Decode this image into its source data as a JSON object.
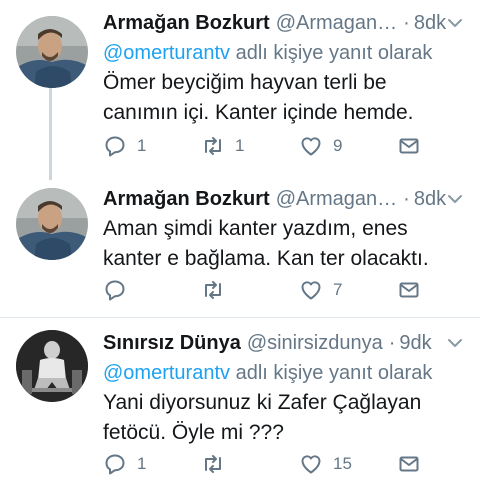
{
  "tweets": [
    {
      "name": "Armağan Bozkurt",
      "handle": "@Armagan…",
      "dot": "·",
      "time": "8dk",
      "reply_mention": "@omerturantv",
      "reply_suffix": " adlı kişiye yanıt olarak",
      "text": "Ömer beyciğim hayvan terli be canımın içi. Kanter içinde hemde.",
      "replies": "1",
      "retweets": "1",
      "likes": "9"
    },
    {
      "name": "Armağan Bozkurt",
      "handle": "@Armagan…",
      "dot": "·",
      "time": "8dk",
      "text": "Aman şimdi kanter yazdım, enes kanter e bağlama. Kan ter olacaktı.",
      "replies": "",
      "retweets": "",
      "likes": "7"
    },
    {
      "name": "Sınırsız Dünya",
      "handle": "@sinirsizdunya",
      "dot": "·",
      "time": "9dk",
      "reply_mention": "@omerturantv",
      "reply_suffix": " adlı kişiye yanıt olarak",
      "text": "Yani diyorsunuz ki Zafer Çağlayan fetöcü. Öyle mi ???",
      "replies": "1",
      "retweets": "",
      "likes": "15"
    }
  ],
  "icons": {
    "reply": "reply-icon",
    "retweet": "retweet-icon",
    "like": "heart-icon",
    "share": "envelope-icon",
    "menu": "chevron-down-icon"
  },
  "colors": {
    "link": "#1da1f2",
    "muted": "#657786",
    "thread_line": "#ccd6dd",
    "divider": "#e1e8ed"
  }
}
